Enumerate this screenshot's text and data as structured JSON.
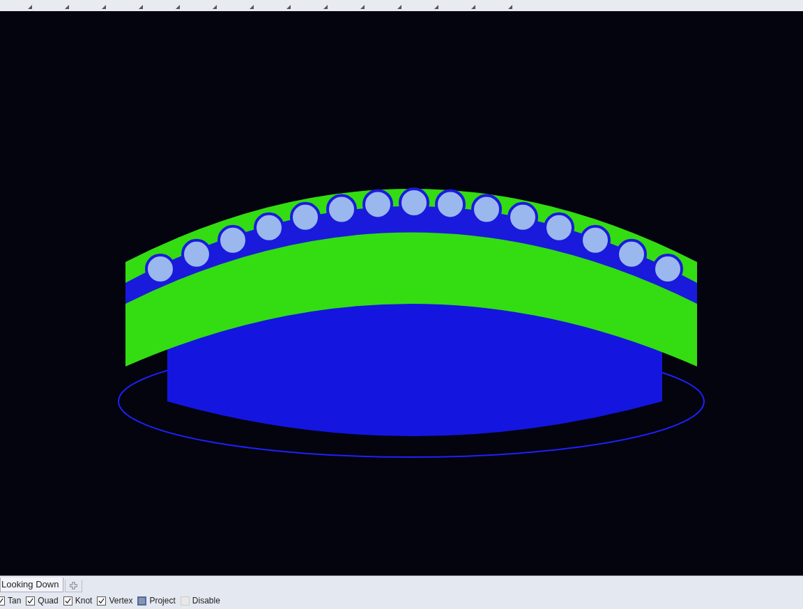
{
  "viewport_tabs": [
    {
      "label": "Looking Down",
      "selected": true
    }
  ],
  "osnap": [
    {
      "label": "Tan",
      "kind": "check",
      "checked": true
    },
    {
      "label": "Quad",
      "kind": "check",
      "checked": true
    },
    {
      "label": "Knot",
      "kind": "check",
      "checked": true
    },
    {
      "label": "Vertex",
      "kind": "check",
      "checked": true
    },
    {
      "label": "Project",
      "kind": "toggle",
      "checked": true
    },
    {
      "label": "Disable",
      "kind": "toggle",
      "checked": false
    }
  ]
}
